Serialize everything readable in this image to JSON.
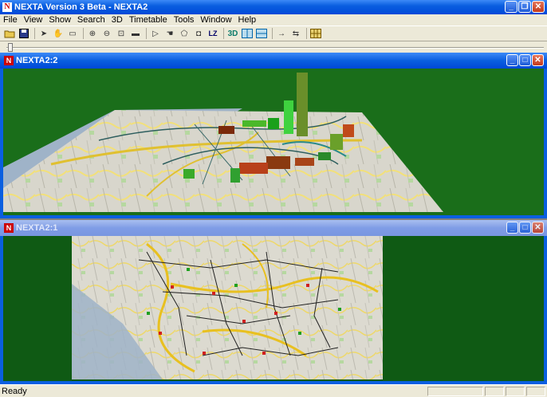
{
  "app": {
    "title": "NEXTA Version 3 Beta - NEXTA2",
    "icon": "N"
  },
  "menu": [
    "File",
    "View",
    "Show",
    "Search",
    "3D",
    "Timetable",
    "Tools",
    "Window",
    "Help"
  ],
  "toolbar": {
    "label_3d": "3D",
    "label_lz": "LZ"
  },
  "windows": {
    "top": {
      "title": "NEXTA2:2",
      "icon": "N",
      "view": "3D perspective map with bar volumes"
    },
    "bottom": {
      "title": "NEXTA2:1",
      "icon": "N",
      "view": "2D network map"
    }
  },
  "status": {
    "text": "Ready"
  },
  "colors": {
    "desktop_green": "#1a6e1a",
    "bottom_green": "#0f5a14",
    "title_blue": "#0a5fe0"
  }
}
